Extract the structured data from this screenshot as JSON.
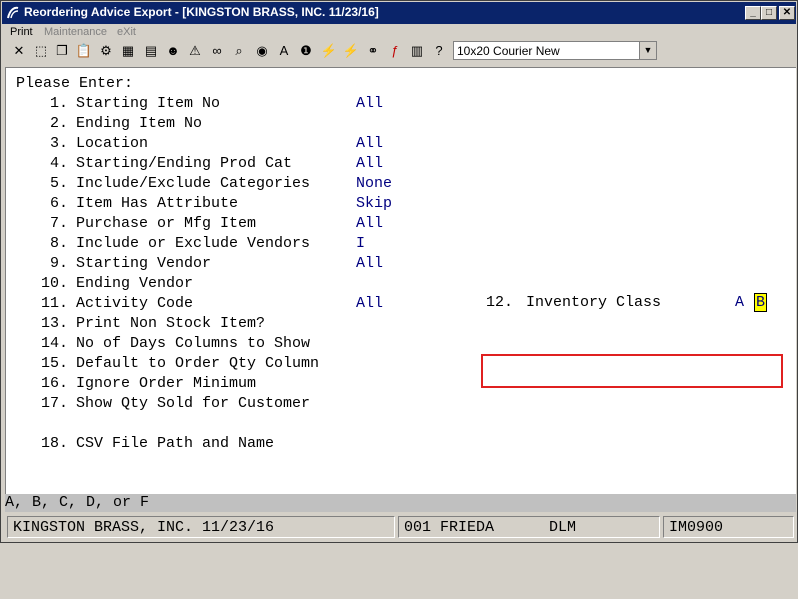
{
  "window": {
    "title": "Reordering Advice Export - [KINGSTON BRASS, INC. 11/23/16]",
    "minimize": "_",
    "maximize": "□",
    "close": "✕"
  },
  "menu": {
    "items": [
      "Print",
      "Maintenance",
      "eXit"
    ]
  },
  "toolbar": {
    "font_selector": "10x20 Courier New"
  },
  "prompt": "Please Enter:",
  "fields": [
    {
      "num": "1.",
      "label": "Starting Item No",
      "value": "All"
    },
    {
      "num": "2.",
      "label": "Ending Item No",
      "value": ""
    },
    {
      "num": "3.",
      "label": "Location",
      "value": "All"
    },
    {
      "num": "4.",
      "label": "Starting/Ending Prod Cat",
      "value": "All"
    },
    {
      "num": "5.",
      "label": "Include/Exclude Categories",
      "value": "None"
    },
    {
      "num": "6.",
      "label": "Item Has Attribute",
      "value": "Skip"
    },
    {
      "num": "7.",
      "label": "Purchase or Mfg Item",
      "value": "All"
    },
    {
      "num": "8.",
      "label": "Include or Exclude Vendors",
      "value": "I"
    },
    {
      "num": "9.",
      "label": "Starting Vendor",
      "value": "All"
    },
    {
      "num": "10.",
      "label": "Ending Vendor",
      "value": ""
    },
    {
      "num": "11.",
      "label": "Activity Code",
      "value": "All"
    },
    {
      "num": "13.",
      "label": "Print Non Stock Item?",
      "value": ""
    },
    {
      "num": "14.",
      "label": "No of Days Columns to Show",
      "value": ""
    },
    {
      "num": "15.",
      "label": "Default to Order Qty Column",
      "value": ""
    },
    {
      "num": "16.",
      "label": "Ignore Order Minimum",
      "value": ""
    },
    {
      "num": "17.",
      "label": "Show Qty Sold for Customer",
      "value": ""
    },
    {
      "num": "18.",
      "label": "CSV File Path and Name",
      "value": ""
    }
  ],
  "inventory_class": {
    "num": "12.",
    "label": "Inventory Class",
    "value_a": "A",
    "value_b": "B"
  },
  "help_line": "A, B, C, D, or F",
  "status": {
    "company": "KINGSTON BRASS, INC. 11/23/16",
    "user": "001 FRIEDA",
    "initials": "DLM",
    "program": "IM0900"
  },
  "colors": {
    "title_bar": "#0a246a",
    "value_text": "#000080",
    "highlight_border": "#e02020",
    "cursor_bg": "#ffff00"
  }
}
